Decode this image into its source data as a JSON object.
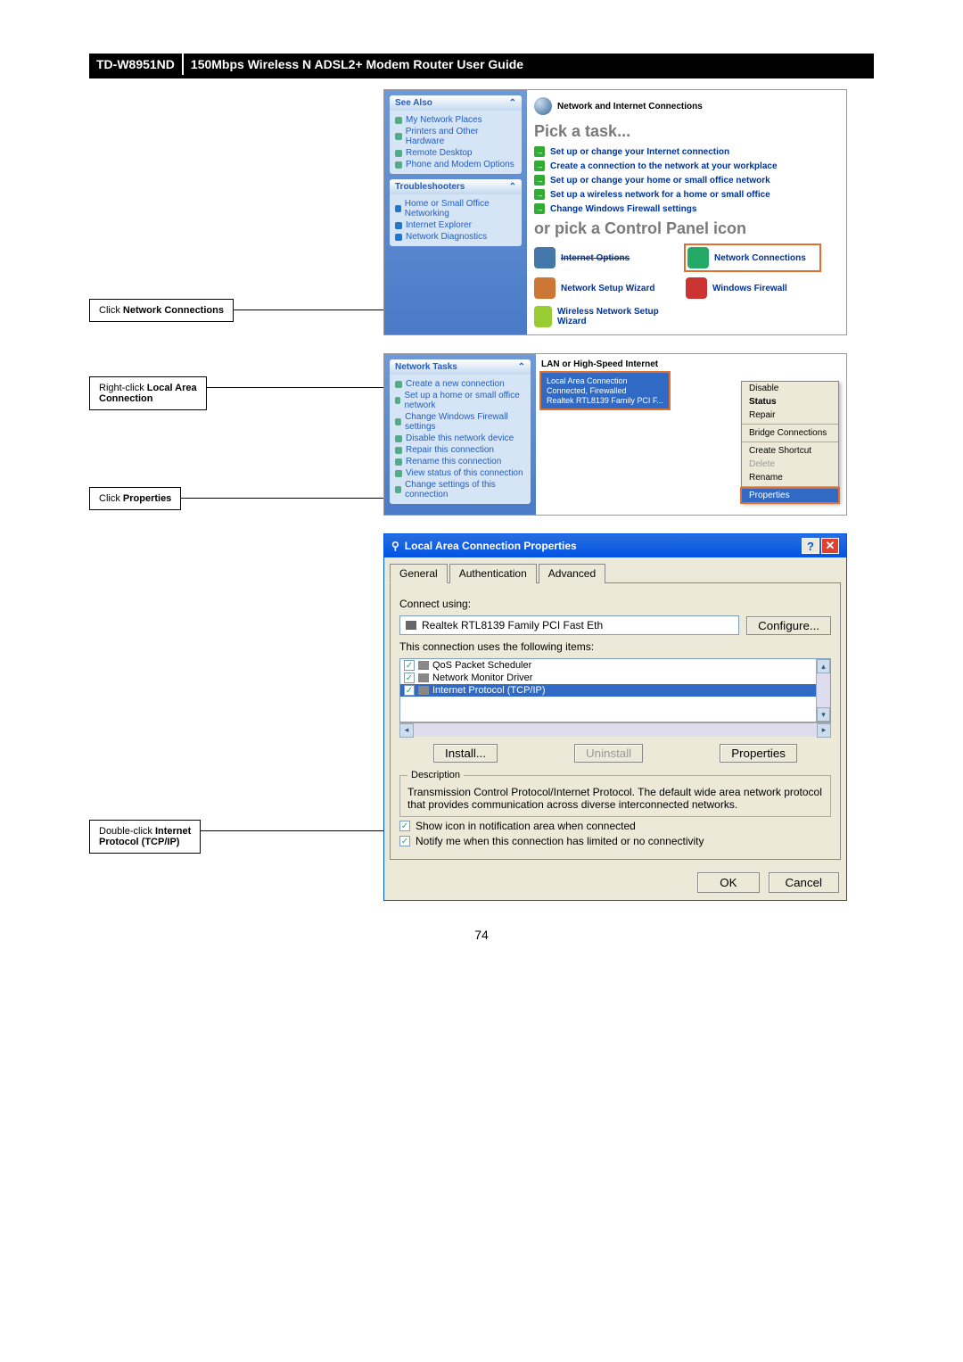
{
  "header": {
    "model": "TD-W8951ND",
    "title": "150Mbps Wireless N ADSL2+ Modem Router User Guide"
  },
  "callouts": {
    "c1": [
      "Click ",
      "Network Connections"
    ],
    "c2a": [
      "Right-click ",
      "Local Area"
    ],
    "c2b": [
      "Connection"
    ],
    "c3": [
      "Click ",
      "Properties"
    ],
    "c4a": [
      "Double-click ",
      "Internet"
    ],
    "c4b": [
      "Protocol (TCP/IP)"
    ]
  },
  "cp": {
    "seeAlsoHead": "See Also",
    "seeAlso": [
      "My Network Places",
      "Printers and Other Hardware",
      "Remote Desktop",
      "Phone and Modem Options"
    ],
    "tsHead": "Troubleshooters",
    "ts": [
      "Home or Small Office Networking",
      "Internet Explorer",
      "Network Diagnostics"
    ],
    "catTitle": "Network and Internet Connections",
    "pick": "Pick a task...",
    "tasks": [
      "Set up or change your Internet connection",
      "Create a connection to the network at your workplace",
      "Set up or change your home or small office network",
      "Set up a wireless network for a home or small office",
      "Change Windows Firewall settings"
    ],
    "orPick": "or pick a Control Panel icon",
    "icons": {
      "io": "Internet Options",
      "nc": "Network Connections",
      "nsw": "Network Setup Wizard",
      "wf": "Windows Firewall",
      "wns": "Wireless Network Setup Wizard"
    }
  },
  "nc": {
    "ntHead": "Network Tasks",
    "tasks": [
      "Create a new connection",
      "Set up a home or small office network",
      "Change Windows Firewall settings",
      "Disable this network device",
      "Repair this connection",
      "Rename this connection",
      "View status of this connection",
      "Change settings of this connection"
    ],
    "lanHeader": "LAN or High-Speed Internet",
    "lanName": "Local Area Connection",
    "lanStatus": "Connected, Firewalled",
    "lanDevice": "Realtek RTL8139 Family PCI F...",
    "ctx": {
      "disable": "Disable",
      "status": "Status",
      "repair": "Repair",
      "bridge": "Bridge Connections",
      "shortcut": "Create Shortcut",
      "del": "Delete",
      "rename": "Rename",
      "props": "Properties"
    }
  },
  "prop": {
    "title": "Local Area Connection Properties",
    "tabs": {
      "general": "General",
      "auth": "Authentication",
      "adv": "Advanced"
    },
    "connectUsing": "Connect using:",
    "adapter": "Realtek RTL8139 Family PCI Fast Eth",
    "configure": "Configure...",
    "usesItems": "This connection uses the following items:",
    "items": {
      "qos": "QoS Packet Scheduler",
      "nmd": "Network Monitor Driver",
      "tcpip": "Internet Protocol (TCP/IP)"
    },
    "install": "Install...",
    "uninstall": "Uninstall",
    "propsBtn": "Properties",
    "descHead": "Description",
    "desc": "Transmission Control Protocol/Internet Protocol. The default wide area network protocol that provides communication across diverse interconnected networks.",
    "showIcon": "Show icon in notification area when connected",
    "notify": "Notify me when this connection has limited or no connectivity",
    "ok": "OK",
    "cancel": "Cancel"
  },
  "pageNum": "74"
}
